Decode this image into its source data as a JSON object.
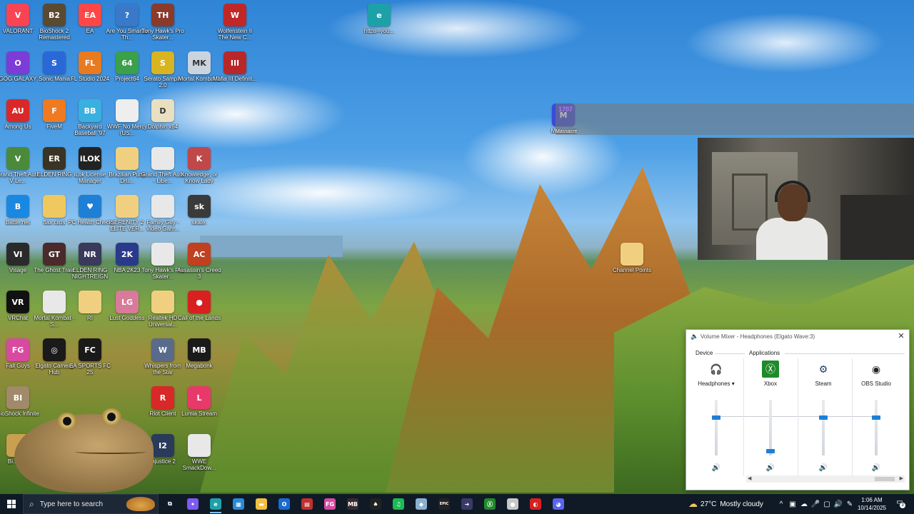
{
  "desktop": {
    "icons": [
      {
        "label": "VALORANT",
        "color": "#fa4454",
        "glyph": "V"
      },
      {
        "label": "BioShock 2 Remastered",
        "color": "#5a4a30",
        "glyph": "B2"
      },
      {
        "label": "EA",
        "color": "#ff4747",
        "glyph": "EA"
      },
      {
        "label": "Are You Smarter Th...",
        "color": "#3a78c9",
        "glyph": "?"
      },
      {
        "label": "Tony Hawk's Pro Skater...",
        "color": "#8a3a2a",
        "glyph": "TH"
      },
      {
        "label": "Wolfenstein II The New C...",
        "color": "#c02828",
        "glyph": "W"
      },
      {
        "label": "https--you...",
        "color": "#1da1a8",
        "glyph": "e"
      },
      {
        "label": "GOG GALAXY",
        "color": "#7d3bd8",
        "glyph": "O"
      },
      {
        "label": "Sonic Mania",
        "color": "#2a68d8",
        "glyph": "S"
      },
      {
        "label": "FL Studio 2024",
        "color": "#e87a20",
        "glyph": "FL"
      },
      {
        "label": "Project64",
        "color": "#3aa04a",
        "glyph": "64"
      },
      {
        "label": "Serato Sample 2.0",
        "color": "#d8b420",
        "glyph": "S"
      },
      {
        "label": "Mortal Kombat 1",
        "color": "#c9d4de",
        "glyph": "MK"
      },
      {
        "label": "Mafia III Definiti...",
        "color": "#b82828",
        "glyph": "III"
      },
      {
        "label": "Among Us",
        "color": "#d82828",
        "glyph": "AU"
      },
      {
        "label": "FiveM",
        "color": "#f07a20",
        "glyph": "F"
      },
      {
        "label": "Backyard Baseball '97",
        "color": "#3ab0e0",
        "glyph": "BB"
      },
      {
        "label": "WWF No Mercy (US...",
        "color": "#eeeeee",
        "glyph": ""
      },
      {
        "label": "Dolphin x64",
        "color": "#e8e0c0",
        "glyph": "D"
      },
      {
        "label": "Grand Theft Auto V Le...",
        "color": "#4a8a3a",
        "glyph": "V"
      },
      {
        "label": "ELDEN RING",
        "color": "#3a3424",
        "glyph": "ER"
      },
      {
        "label": "iLok License Manager",
        "color": "#222222",
        "glyph": "iLOK"
      },
      {
        "label": "Brazilian Punk Dru...",
        "color": "#f0d080",
        "glyph": ""
      },
      {
        "label": "Grand Theft Auto - Libe...",
        "color": "#e8e8e8",
        "glyph": ""
      },
      {
        "label": "Knowledge, or Know Lady",
        "color": "#c04848",
        "glyph": "K"
      },
      {
        "label": "Battle.net",
        "color": "#1a88e0",
        "glyph": "B"
      },
      {
        "label": "flax clips",
        "color": "#f0c860",
        "glyph": ""
      },
      {
        "label": "PC Health Check",
        "color": "#1e7fd6",
        "glyph": "♥"
      },
      {
        "label": "SERENITY 2 ELITE VER...",
        "color": "#f0d080",
        "glyph": ""
      },
      {
        "label": "Family Guy - Video Gam...",
        "color": "#e8e8e8",
        "glyph": ""
      },
      {
        "label": "skate.",
        "color": "#3a3a3a",
        "glyph": "sk"
      },
      {
        "label": "Visage",
        "color": "#2a2a2a",
        "glyph": "VI"
      },
      {
        "label": "The Ghost Train",
        "color": "#4a2a2a",
        "glyph": "GT"
      },
      {
        "label": "ELDEN RING NIGHTREIGN",
        "color": "#3a3a5a",
        "glyph": "NR"
      },
      {
        "label": "NBA 2K23",
        "color": "#2a3a8a",
        "glyph": "2K"
      },
      {
        "label": "Tony Hawk's Pro Skater...",
        "color": "#e8e8e8",
        "glyph": ""
      },
      {
        "label": "Assassin's Creed 3",
        "color": "#c04020",
        "glyph": "AC"
      },
      {
        "label": "VRChat",
        "color": "#111111",
        "glyph": "VR"
      },
      {
        "label": "Mortal Kombat - S...",
        "color": "#e8e8e8",
        "glyph": ""
      },
      {
        "label": "RI",
        "color": "#f0d080",
        "glyph": ""
      },
      {
        "label": "Lust Goddess",
        "color": "#d87a9a",
        "glyph": "LG"
      },
      {
        "label": "Realtek HD Universal...",
        "color": "#f0d080",
        "glyph": ""
      },
      {
        "label": "Call of the Lands",
        "color": "#d82020",
        "glyph": "●"
      },
      {
        "label": "Fall Guys",
        "color": "#d84aa0",
        "glyph": "FG"
      },
      {
        "label": "Elgato Camera Hub",
        "color": "#1a1a1a",
        "glyph": "◎"
      },
      {
        "label": "EA SPORTS FC 25",
        "color": "#1a1a1a",
        "glyph": "FC"
      },
      {
        "label": "Whispers from the Star",
        "color": "#5a6a8a",
        "glyph": "W"
      },
      {
        "label": "Megabonk",
        "color": "#1a1a1a",
        "glyph": "MB"
      },
      {
        "label": "BioShock Infinite",
        "color": "#a08a6a",
        "glyph": "BI"
      },
      {
        "label": "Riot Client",
        "color": "#d82828",
        "glyph": "R"
      },
      {
        "label": "Lumia Stream",
        "color": "#e83a6a",
        "glyph": "L"
      },
      {
        "label": "Injustice 2",
        "color": "#2a3a5a",
        "glyph": "I2"
      },
      {
        "label": "WWE SmackDow...",
        "color": "#e8e8e8",
        "glyph": ""
      },
      {
        "label": "Bi... R...",
        "color": "#c8a050",
        "glyph": ""
      },
      {
        "label": "Channel Points",
        "color": "#f0d080",
        "glyph": ""
      },
      {
        "label": "Massacre",
        "color": "#3a4ad8",
        "glyph": "M"
      }
    ]
  },
  "overlay": {
    "tag": "1707",
    "caption": "Massacre"
  },
  "mixer": {
    "title": "Volume Mixer - Headphones (Elgato Wave:3)",
    "close": "✕",
    "device_section": "Device",
    "applications_section": "Applications",
    "channels": [
      {
        "name": "Headphones ▾",
        "icon": "headphones-icon",
        "glyph": "🎧",
        "level": 0.7
      },
      {
        "name": "Xbox",
        "icon": "xbox-icon",
        "glyph": "Ⓧ",
        "level": 0.04
      },
      {
        "name": "Steam",
        "icon": "steam-icon",
        "glyph": "⚙",
        "level": 0.7
      },
      {
        "name": "OBS Studio",
        "icon": "obs-icon",
        "glyph": "◉",
        "level": 0.7
      }
    ],
    "speaker_glyph": "🔊"
  },
  "taskbar": {
    "search_placeholder": "Type here to search",
    "apps": [
      {
        "name": "task-view",
        "glyph": "⧉",
        "color": "#0f1a26"
      },
      {
        "name": "copilot",
        "glyph": "✦",
        "color": "#7d5af0"
      },
      {
        "name": "edge",
        "glyph": "e",
        "color": "#1da1a8"
      },
      {
        "name": "store",
        "glyph": "▦",
        "color": "#2a8ad8"
      },
      {
        "name": "file-explorer",
        "glyph": "▬",
        "color": "#f0c040"
      },
      {
        "name": "outlook",
        "glyph": "O",
        "color": "#1a6ad0"
      },
      {
        "name": "app-7",
        "glyph": "▤",
        "color": "#c03030"
      },
      {
        "name": "fall-guys",
        "glyph": "FG",
        "color": "#d84aa0"
      },
      {
        "name": "megabonk",
        "glyph": "MB",
        "color": "#3a2a2a"
      },
      {
        "name": "app-10",
        "glyph": "♠",
        "color": "#222222"
      },
      {
        "name": "spotify",
        "glyph": "♫",
        "color": "#1db954"
      },
      {
        "name": "app-12",
        "glyph": "◆",
        "color": "#8ab0d0"
      },
      {
        "name": "epic-games",
        "glyph": "EPIC",
        "color": "#222222"
      },
      {
        "name": "app-14",
        "glyph": "➜",
        "color": "#3a3a6a"
      },
      {
        "name": "xbox",
        "glyph": "Ⓧ",
        "color": "#1f8a2a"
      },
      {
        "name": "app-16",
        "glyph": "●",
        "color": "#c8c8c8"
      },
      {
        "name": "app-17",
        "glyph": "◐",
        "color": "#d82020"
      },
      {
        "name": "discord",
        "glyph": "◕",
        "color": "#5865f2"
      }
    ],
    "weather_temp": "27°C",
    "weather_text": "Mostly cloudy",
    "time": "1:06 AM",
    "date": "10/14/2025",
    "tray": [
      "^",
      "▣",
      "☁",
      "🎤",
      "▢",
      "🔊",
      "✎"
    ],
    "notification_count": "3"
  }
}
